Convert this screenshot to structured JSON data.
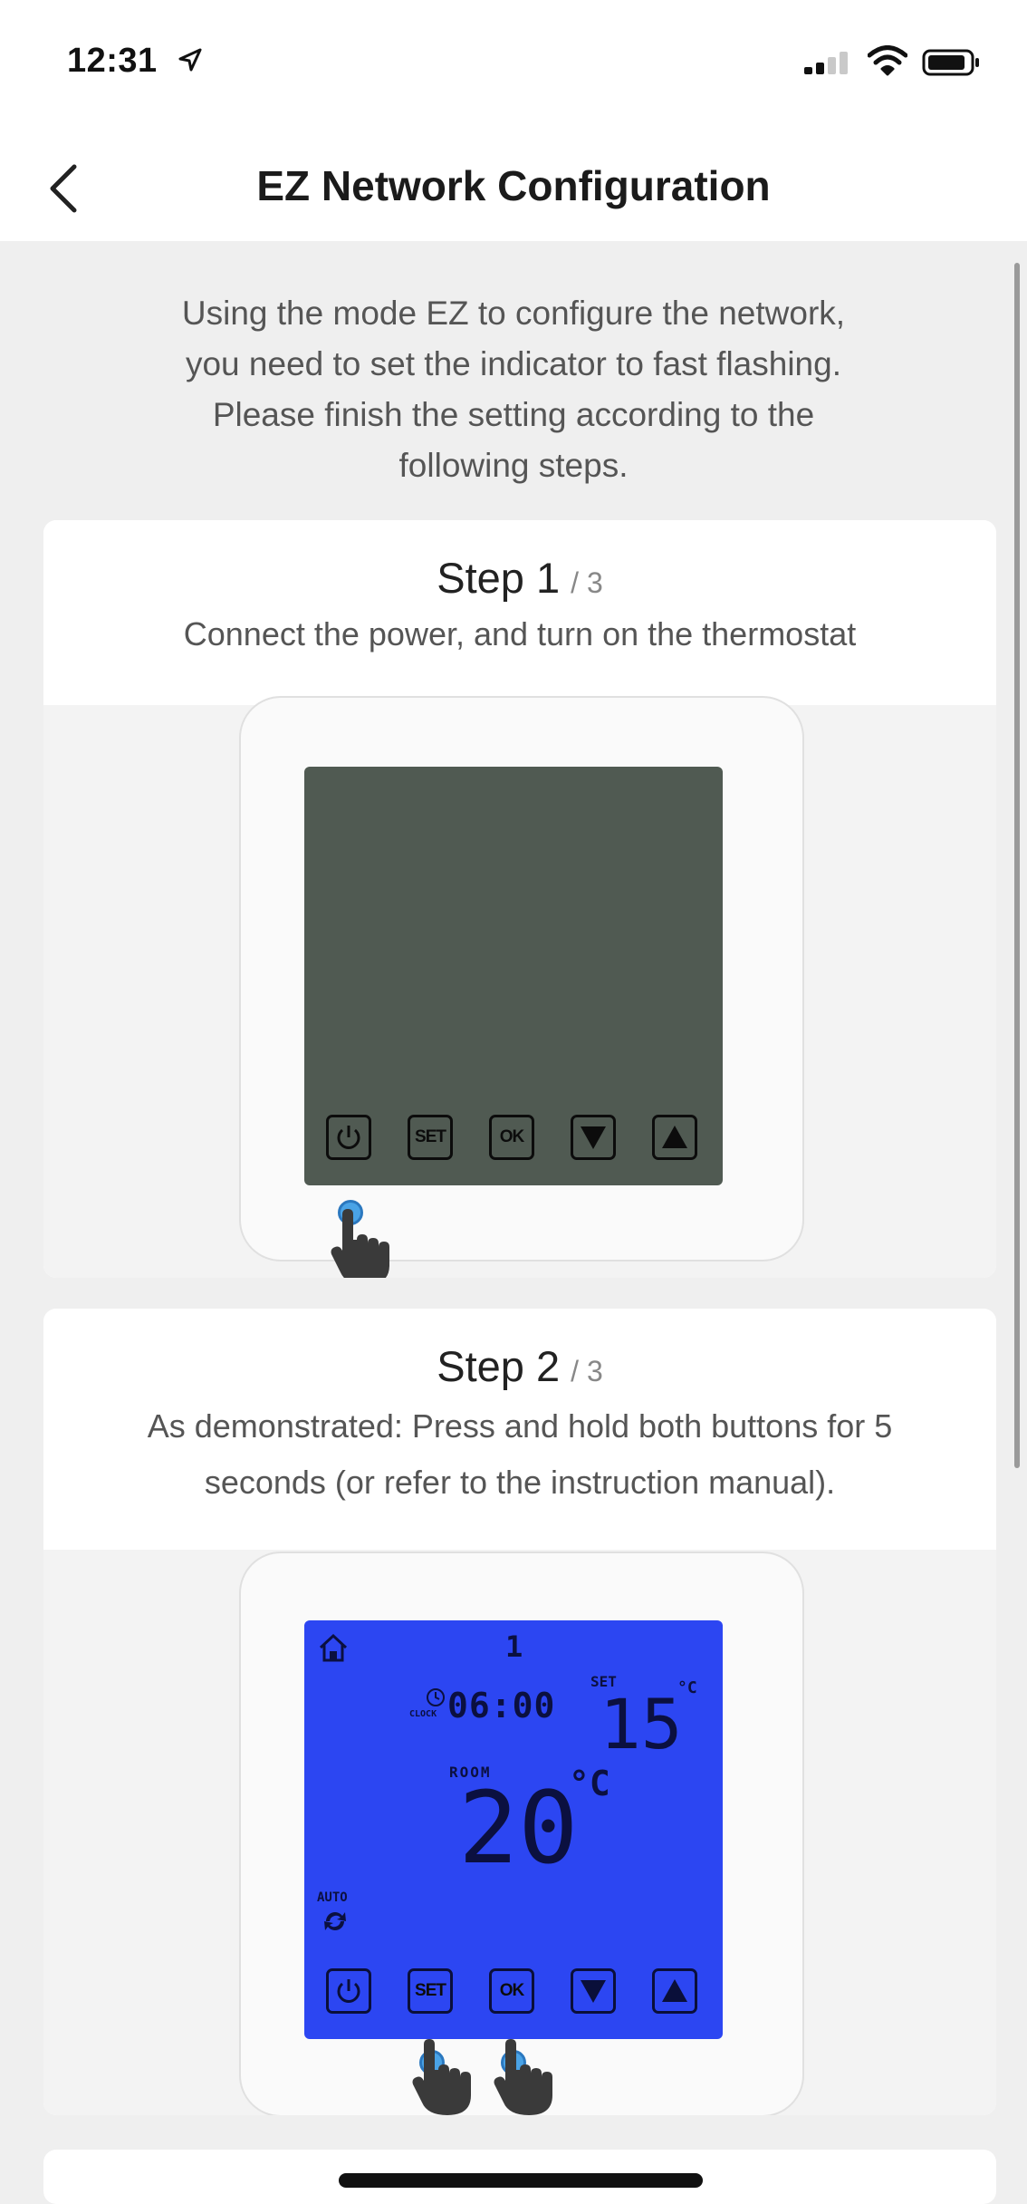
{
  "status": {
    "time": "12:31",
    "icons": [
      "location-arrow-icon",
      "signal-icon",
      "wifi-icon",
      "battery-icon"
    ]
  },
  "nav": {
    "title": "EZ Network Configuration",
    "back_icon": "chevron-left-icon"
  },
  "intro": {
    "lines": [
      "Using the mode EZ to configure the network,",
      "you need to set the indicator to fast flashing.",
      "Please finish the setting according to the",
      "following steps."
    ]
  },
  "steps": [
    {
      "label": "Step 1",
      "count": "/ 3",
      "description": [
        "Connect the power, and turn on the thermostat"
      ],
      "display": "off"
    },
    {
      "label": "Step 2",
      "count": "/ 3",
      "description": [
        "As demonstrated: Press and hold both buttons for 5",
        "seconds (or refer to the instruction manual)."
      ],
      "display": "on"
    }
  ],
  "thermostat": {
    "buttons": [
      "power",
      "SET",
      "OK",
      "down",
      "up"
    ],
    "set_label": "SET",
    "ok_label": "OK",
    "lcd": {
      "period": "1",
      "clock_label": "CLOCK",
      "clock_time": "06:00",
      "set_label": "SET",
      "set_temp": "15",
      "set_unit": "°C",
      "room_label": "ROOM",
      "room_temp": "20",
      "room_unit": "°C",
      "auto_label": "AUTO"
    }
  },
  "colors": {
    "lcd_off": "#505a52",
    "lcd_on": "#2c46f2",
    "touch_dot": "#4aa3e6"
  }
}
